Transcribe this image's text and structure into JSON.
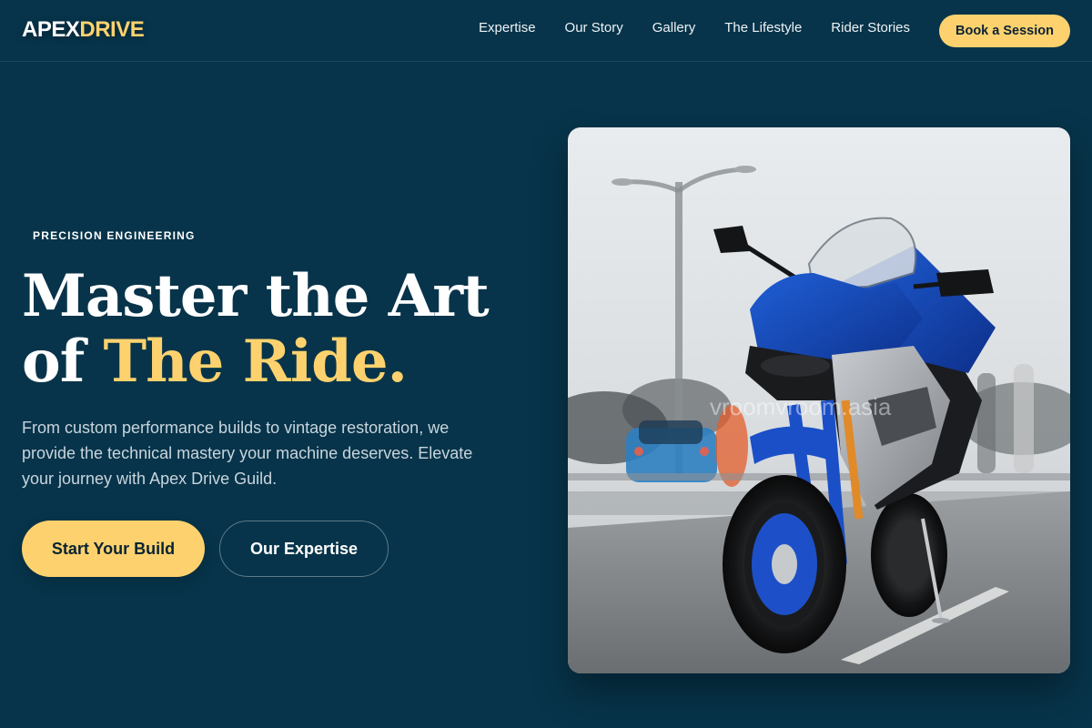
{
  "brand": {
    "part1": "APEX",
    "part2": "DRIVE"
  },
  "nav": {
    "links": [
      "Expertise",
      "Our Story",
      "Gallery",
      "The Lifestyle",
      "Rider Stories"
    ],
    "cta": "Book a Session"
  },
  "hero": {
    "eyebrow": "PRECISION ENGINEERING",
    "headline_line1": "Master the Art",
    "headline_of": "of ",
    "headline_accent": "The Ride.",
    "lede": "From custom performance builds to vintage restoration, we provide the technical mastery your machine deserves. Elevate your journey with Apex Drive Guild.",
    "primary_cta": "Start Your Build",
    "secondary_cta": "Our Expertise",
    "image": {
      "subject": "blue-sport-motorcycle-photo",
      "watermark": "vroomvroom.asia"
    }
  },
  "colors": {
    "background": "#07344a",
    "accent": "#fdd26e",
    "text": "#ffffff",
    "muted_text": "#c8d5dd"
  }
}
